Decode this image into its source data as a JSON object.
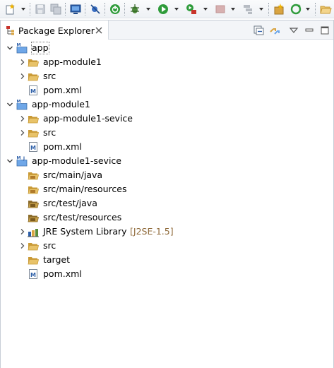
{
  "view": {
    "title": "Package Explorer"
  },
  "tree": [
    {
      "label": "app",
      "kind": "maven-project",
      "level": 0,
      "expanded": true
    },
    {
      "label": "app-module1",
      "kind": "folder",
      "level": 1,
      "expanded": false
    },
    {
      "label": "src",
      "kind": "folder",
      "level": 1,
      "expanded": false
    },
    {
      "label": "pom.xml",
      "kind": "pom",
      "level": 1
    },
    {
      "label": "app-module1",
      "kind": "maven-project",
      "level": 0,
      "expanded": true
    },
    {
      "label": "app-module1-sevice",
      "kind": "folder",
      "level": 1,
      "expanded": false
    },
    {
      "label": "src",
      "kind": "folder",
      "level": 1,
      "expanded": false
    },
    {
      "label": "pom.xml",
      "kind": "pom",
      "level": 1
    },
    {
      "label": "app-module1-sevice",
      "kind": "java-maven-project",
      "level": 0,
      "expanded": true
    },
    {
      "label": "src/main/java",
      "kind": "source-folder",
      "level": 1
    },
    {
      "label": "src/main/resources",
      "kind": "source-folder",
      "level": 1
    },
    {
      "label": "src/test/java",
      "kind": "source-folder-test",
      "level": 1
    },
    {
      "label": "src/test/resources",
      "kind": "source-folder-test",
      "level": 1
    },
    {
      "label": "JRE System Library",
      "decoration": "[J2SE-1.5]",
      "kind": "library",
      "level": 1,
      "expanded": false
    },
    {
      "label": "src",
      "kind": "folder",
      "level": 1,
      "expanded": false
    },
    {
      "label": "target",
      "kind": "folder",
      "level": 1
    },
    {
      "label": "pom.xml",
      "kind": "pom",
      "level": 1
    }
  ],
  "colors": {
    "folder": "#e8c36a",
    "folder_dark": "#c99a36",
    "pom_blue": "#2d5fa8",
    "decoration": "#8f6a3a"
  }
}
